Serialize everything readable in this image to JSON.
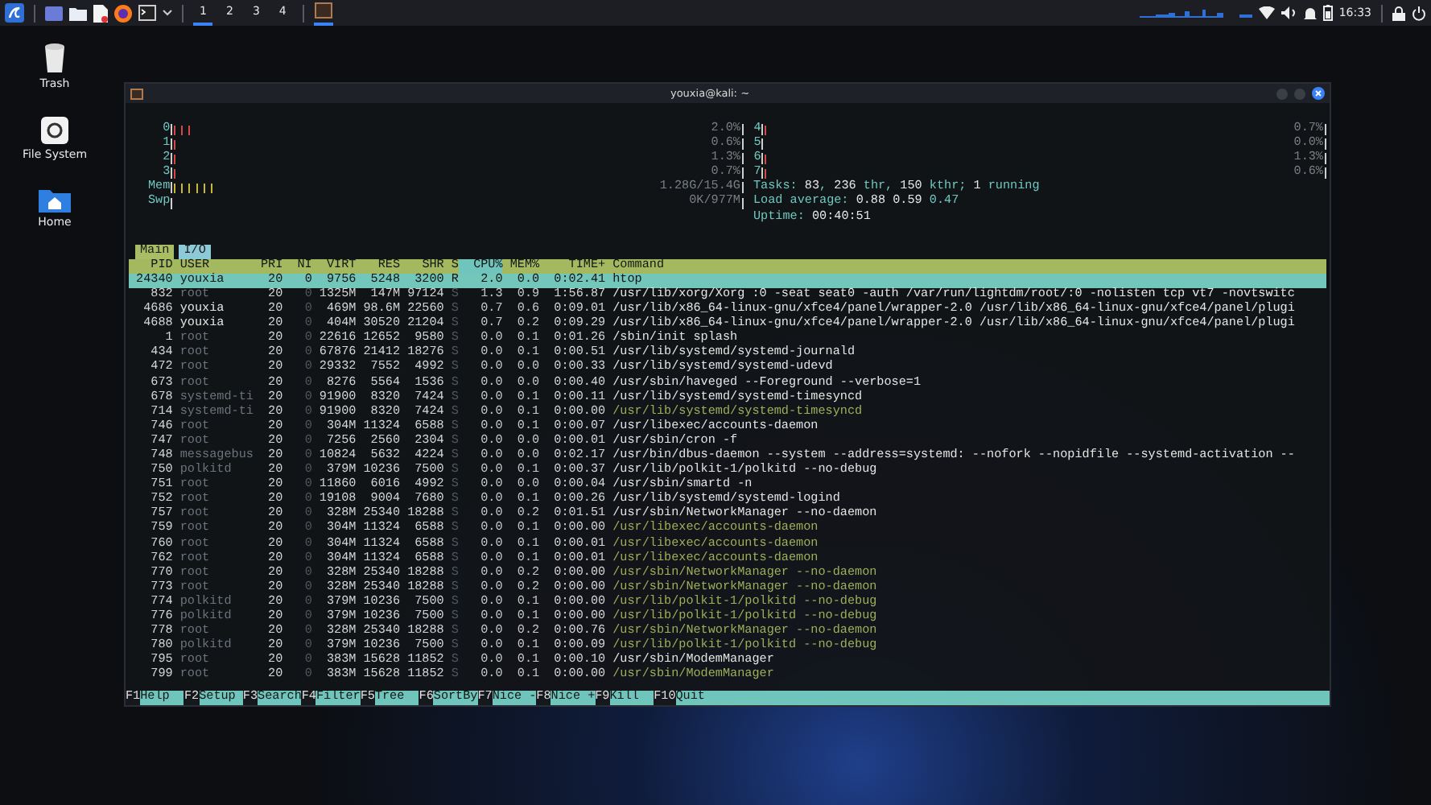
{
  "top_panel": {
    "workspaces": [
      {
        "label": "1",
        "selected": true
      },
      {
        "label": "2",
        "selected": false
      },
      {
        "label": "3",
        "selected": false
      },
      {
        "label": "4",
        "selected": false
      }
    ],
    "clock": "16:33"
  },
  "desktop_icons": [
    {
      "label": "Trash",
      "kind": "trash"
    },
    {
      "label": "File System",
      "kind": "drive"
    },
    {
      "label": "Home",
      "kind": "home"
    }
  ],
  "window": {
    "title": "youxia@kali: ~"
  },
  "htop": {
    "cpu_meters": [
      {
        "label": "0",
        "level": 0.03,
        "reading": "2.0%"
      },
      {
        "label": "1",
        "level": 0.01,
        "reading": "0.6%"
      },
      {
        "label": "2",
        "level": 0.01,
        "reading": "1.3%"
      },
      {
        "label": "3",
        "level": 0.01,
        "reading": "0.7%"
      },
      {
        "label": "4",
        "level": 0.01,
        "reading": "0.7%"
      },
      {
        "label": "5",
        "level": 0,
        "reading": "0.0%"
      },
      {
        "label": "6",
        "level": 0.01,
        "reading": "1.3%"
      },
      {
        "label": "7",
        "level": 0.01,
        "reading": "0.6%"
      }
    ],
    "memory_meters": [
      {
        "label": "Mem",
        "level": 0.08,
        "reading": "1.28G/15.4G"
      },
      {
        "label": "Swp",
        "level": 0,
        "reading": "0K/977M"
      }
    ],
    "summary": [
      "Tasks: **83**, **236** thr, **150** kthr; **1** running",
      "Load average: **0.88** **0.59** 0.47",
      "Uptime: **00:40:51**"
    ],
    "tabs": [
      {
        "label": "Main",
        "selected": true
      },
      {
        "label": "I/O",
        "selected": false
      }
    ],
    "columns": [
      {
        "label": "PID",
        "sorted": false
      },
      {
        "label": "USER",
        "sorted": false
      },
      {
        "label": "PRI",
        "sorted": false
      },
      {
        "label": "NI",
        "sorted": false
      },
      {
        "label": "VIRT",
        "sorted": false
      },
      {
        "label": "RES",
        "sorted": false
      },
      {
        "label": "SHR",
        "sorted": false
      },
      {
        "label": "S",
        "sorted": false
      },
      {
        "label": "CPU%",
        "sorted": true
      },
      {
        "label": "MEM%",
        "sorted": false
      },
      {
        "label": "TIME+",
        "sorted": false
      },
      {
        "label": "Command",
        "sorted": false
      }
    ],
    "rows": [
      {
        "cells": [
          "24340",
          "youxia",
          "20",
          "0",
          "9756",
          "5248",
          "3200",
          "R",
          "2.0",
          "0.0",
          "0:02.41",
          "htop"
        ],
        "selected": true,
        "current_user": true,
        "thread": false
      },
      {
        "cells": [
          "832",
          "root",
          "20",
          "0",
          "1325M",
          "147M",
          "97124",
          "S",
          "1.3",
          "0.9",
          "1:56.87",
          "/usr/lib/xorg/Xorg :0 -seat seat0 -auth /var/run/lightdm/root/:0 -nolisten tcp vt7 -novtswitc"
        ],
        "selected": false,
        "current_user": false,
        "thread": false
      },
      {
        "cells": [
          "4686",
          "youxia",
          "20",
          "0",
          "469M",
          "98.6M",
          "22560",
          "S",
          "0.7",
          "0.6",
          "0:09.01",
          "/usr/lib/x86_64-linux-gnu/xfce4/panel/wrapper-2.0 /usr/lib/x86_64-linux-gnu/xfce4/panel/plugi"
        ],
        "selected": false,
        "current_user": true,
        "thread": false
      },
      {
        "cells": [
          "4688",
          "youxia",
          "20",
          "0",
          "404M",
          "30520",
          "21204",
          "S",
          "0.7",
          "0.2",
          "0:09.29",
          "/usr/lib/x86_64-linux-gnu/xfce4/panel/wrapper-2.0 /usr/lib/x86_64-linux-gnu/xfce4/panel/plugi"
        ],
        "selected": false,
        "current_user": true,
        "thread": false
      },
      {
        "cells": [
          "1",
          "root",
          "20",
          "0",
          "22616",
          "12652",
          "9580",
          "S",
          "0.0",
          "0.1",
          "0:01.26",
          "/sbin/init splash"
        ],
        "selected": false,
        "current_user": false,
        "thread": false
      },
      {
        "cells": [
          "434",
          "root",
          "20",
          "0",
          "67876",
          "21412",
          "18276",
          "S",
          "0.0",
          "0.1",
          "0:00.51",
          "/usr/lib/systemd/systemd-journald"
        ],
        "selected": false,
        "current_user": false,
        "thread": false
      },
      {
        "cells": [
          "472",
          "root",
          "20",
          "0",
          "29332",
          "7552",
          "4992",
          "S",
          "0.0",
          "0.0",
          "0:00.33",
          "/usr/lib/systemd/systemd-udevd"
        ],
        "selected": false,
        "current_user": false,
        "thread": false
      },
      {
        "cells": [
          "673",
          "root",
          "20",
          "0",
          "8276",
          "5564",
          "1536",
          "S",
          "0.0",
          "0.0",
          "0:00.40",
          "/usr/sbin/haveged --Foreground --verbose=1"
        ],
        "selected": false,
        "current_user": false,
        "thread": false
      },
      {
        "cells": [
          "678",
          "systemd-ti",
          "20",
          "0",
          "91900",
          "8320",
          "7424",
          "S",
          "0.0",
          "0.1",
          "0:00.11",
          "/usr/lib/systemd/systemd-timesyncd"
        ],
        "selected": false,
        "current_user": false,
        "thread": false
      },
      {
        "cells": [
          "714",
          "systemd-ti",
          "20",
          "0",
          "91900",
          "8320",
          "7424",
          "S",
          "0.0",
          "0.1",
          "0:00.00",
          "/usr/lib/systemd/systemd-timesyncd"
        ],
        "selected": false,
        "current_user": false,
        "thread": true
      },
      {
        "cells": [
          "746",
          "root",
          "20",
          "0",
          "304M",
          "11324",
          "6588",
          "S",
          "0.0",
          "0.1",
          "0:00.07",
          "/usr/libexec/accounts-daemon"
        ],
        "selected": false,
        "current_user": false,
        "thread": false
      },
      {
        "cells": [
          "747",
          "root",
          "20",
          "0",
          "7256",
          "2560",
          "2304",
          "S",
          "0.0",
          "0.0",
          "0:00.01",
          "/usr/sbin/cron -f"
        ],
        "selected": false,
        "current_user": false,
        "thread": false
      },
      {
        "cells": [
          "748",
          "messagebus",
          "20",
          "0",
          "10824",
          "5632",
          "4224",
          "S",
          "0.0",
          "0.0",
          "0:02.17",
          "/usr/bin/dbus-daemon --system --address=systemd: --nofork --nopidfile --systemd-activation --"
        ],
        "selected": false,
        "current_user": false,
        "thread": false
      },
      {
        "cells": [
          "750",
          "polkitd",
          "20",
          "0",
          "379M",
          "10236",
          "7500",
          "S",
          "0.0",
          "0.1",
          "0:00.37",
          "/usr/lib/polkit-1/polkitd --no-debug"
        ],
        "selected": false,
        "current_user": false,
        "thread": false
      },
      {
        "cells": [
          "751",
          "root",
          "20",
          "0",
          "11860",
          "6016",
          "4992",
          "S",
          "0.0",
          "0.0",
          "0:00.04",
          "/usr/sbin/smartd -n"
        ],
        "selected": false,
        "current_user": false,
        "thread": false
      },
      {
        "cells": [
          "752",
          "root",
          "20",
          "0",
          "19108",
          "9004",
          "7680",
          "S",
          "0.0",
          "0.1",
          "0:00.26",
          "/usr/lib/systemd/systemd-logind"
        ],
        "selected": false,
        "current_user": false,
        "thread": false
      },
      {
        "cells": [
          "757",
          "root",
          "20",
          "0",
          "328M",
          "25340",
          "18288",
          "S",
          "0.0",
          "0.2",
          "0:01.51",
          "/usr/sbin/NetworkManager --no-daemon"
        ],
        "selected": false,
        "current_user": false,
        "thread": false
      },
      {
        "cells": [
          "759",
          "root",
          "20",
          "0",
          "304M",
          "11324",
          "6588",
          "S",
          "0.0",
          "0.1",
          "0:00.00",
          "/usr/libexec/accounts-daemon"
        ],
        "selected": false,
        "current_user": false,
        "thread": true
      },
      {
        "cells": [
          "760",
          "root",
          "20",
          "0",
          "304M",
          "11324",
          "6588",
          "S",
          "0.0",
          "0.1",
          "0:00.01",
          "/usr/libexec/accounts-daemon"
        ],
        "selected": false,
        "current_user": false,
        "thread": true
      },
      {
        "cells": [
          "762",
          "root",
          "20",
          "0",
          "304M",
          "11324",
          "6588",
          "S",
          "0.0",
          "0.1",
          "0:00.01",
          "/usr/libexec/accounts-daemon"
        ],
        "selected": false,
        "current_user": false,
        "thread": true
      },
      {
        "cells": [
          "770",
          "root",
          "20",
          "0",
          "328M",
          "25340",
          "18288",
          "S",
          "0.0",
          "0.2",
          "0:00.00",
          "/usr/sbin/NetworkManager --no-daemon"
        ],
        "selected": false,
        "current_user": false,
        "thread": true
      },
      {
        "cells": [
          "773",
          "root",
          "20",
          "0",
          "328M",
          "25340",
          "18288",
          "S",
          "0.0",
          "0.2",
          "0:00.00",
          "/usr/sbin/NetworkManager --no-daemon"
        ],
        "selected": false,
        "current_user": false,
        "thread": true
      },
      {
        "cells": [
          "774",
          "polkitd",
          "20",
          "0",
          "379M",
          "10236",
          "7500",
          "S",
          "0.0",
          "0.1",
          "0:00.00",
          "/usr/lib/polkit-1/polkitd --no-debug"
        ],
        "selected": false,
        "current_user": false,
        "thread": true
      },
      {
        "cells": [
          "776",
          "polkitd",
          "20",
          "0",
          "379M",
          "10236",
          "7500",
          "S",
          "0.0",
          "0.1",
          "0:00.00",
          "/usr/lib/polkit-1/polkitd --no-debug"
        ],
        "selected": false,
        "current_user": false,
        "thread": true
      },
      {
        "cells": [
          "778",
          "root",
          "20",
          "0",
          "328M",
          "25340",
          "18288",
          "S",
          "0.0",
          "0.2",
          "0:00.76",
          "/usr/sbin/NetworkManager --no-daemon"
        ],
        "selected": false,
        "current_user": false,
        "thread": true
      },
      {
        "cells": [
          "780",
          "polkitd",
          "20",
          "0",
          "379M",
          "10236",
          "7500",
          "S",
          "0.0",
          "0.1",
          "0:00.09",
          "/usr/lib/polkit-1/polkitd --no-debug"
        ],
        "selected": false,
        "current_user": false,
        "thread": true
      },
      {
        "cells": [
          "795",
          "root",
          "20",
          "0",
          "383M",
          "15628",
          "11852",
          "S",
          "0.0",
          "0.1",
          "0:00.10",
          "/usr/sbin/ModemManager"
        ],
        "selected": false,
        "current_user": false,
        "thread": false
      },
      {
        "cells": [
          "799",
          "root",
          "20",
          "0",
          "383M",
          "15628",
          "11852",
          "S",
          "0.0",
          "0.1",
          "0:00.00",
          "/usr/sbin/ModemManager"
        ],
        "selected": false,
        "current_user": false,
        "thread": true
      }
    ],
    "function_keys": [
      {
        "key": "F1",
        "label": "Help"
      },
      {
        "key": "F2",
        "label": "Setup"
      },
      {
        "key": "F3",
        "label": "Search"
      },
      {
        "key": "F4",
        "label": "Filter"
      },
      {
        "key": "F5",
        "label": "Tree"
      },
      {
        "key": "F6",
        "label": "SortBy"
      },
      {
        "key": "F7",
        "label": "Nice -"
      },
      {
        "key": "F8",
        "label": "Nice +"
      },
      {
        "key": "F9",
        "label": "Kill"
      },
      {
        "key": "F10",
        "label": "Quit"
      }
    ]
  }
}
